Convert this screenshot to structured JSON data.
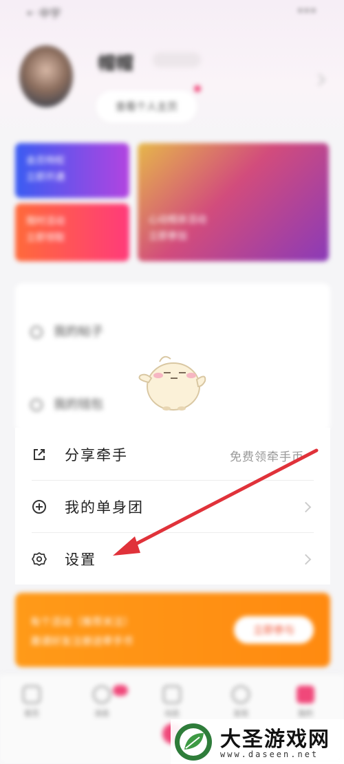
{
  "header": {
    "status_left": "•ᐧ 中宇",
    "status_right": "•••",
    "username": "帽帽",
    "profile_button": "查看个人主页"
  },
  "banners": [
    {
      "line1": "会员特权",
      "line2": "立即开通"
    },
    {
      "line1": "限时活动",
      "line2": "立即领取"
    },
    {
      "line1": "心动相亲活动",
      "line2": "立即参加"
    }
  ],
  "faint_menu": [
    {
      "label": "我的帖子"
    },
    {
      "label": "我的钱包"
    }
  ],
  "menu": {
    "share": {
      "label": "分享牵手",
      "aux": "免费领牵手币"
    },
    "group": {
      "label": "我的单身团"
    },
    "settings": {
      "label": "设置"
    }
  },
  "promo": {
    "line1": "有个活动（推荐关注）",
    "line2": "邀请好友注册送牵手币",
    "button": "立即参与"
  },
  "tabs": [
    {
      "label": "首页"
    },
    {
      "label": "消息"
    },
    {
      "label": "动态"
    },
    {
      "label": "发现"
    },
    {
      "label": "我的"
    }
  ],
  "watermark": {
    "title": "大圣游戏网",
    "domain": "www.daseen.net"
  },
  "colors": {
    "accent": "#f0487a",
    "arrow": "#e0323a",
    "promo": "#ff9a18"
  }
}
